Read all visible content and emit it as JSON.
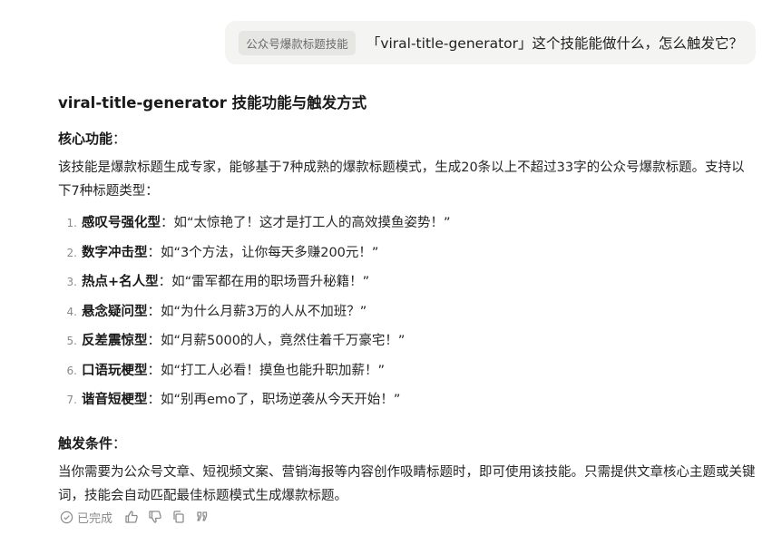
{
  "user_message": {
    "skill_tag": "公众号爆款标题技能",
    "text": "「viral-title-generator」这个技能能做什么，怎么触发它？"
  },
  "answer": {
    "heading": "viral-title-generator 技能功能与触发方式",
    "core": {
      "title": "核心功能",
      "colon": "：",
      "description": "该技能是爆款标题生成专家，能够基于7种成熟的爆款标题模式，生成20条以上不超过33字的公众号爆款标题。支持以下7种标题类型：",
      "items": [
        {
          "num": "1.",
          "name": "感叹号强化型",
          "sep": "：",
          "example": "如“太惊艳了！这才是打工人的高效摸鱼姿势！”"
        },
        {
          "num": "2.",
          "name": "数字冲击型",
          "sep": "：",
          "example": "如“3个方法，让你每天多赚200元！”"
        },
        {
          "num": "3.",
          "name": "热点+名人型",
          "sep": "：",
          "example": "如“雷军都在用的职场晋升秘籍！”"
        },
        {
          "num": "4.",
          "name": "悬念疑问型",
          "sep": "：",
          "example": "如“为什么月薪3万的人从不加班？”"
        },
        {
          "num": "5.",
          "name": "反差震惊型",
          "sep": "：",
          "example": "如“月薪5000的人，竟然住着千万豪宅！”"
        },
        {
          "num": "6.",
          "name": "口语玩梗型",
          "sep": "：",
          "example": "如“打工人必看！摸鱼也能升职加薪！”"
        },
        {
          "num": "7.",
          "name": "谐音短梗型",
          "sep": "：",
          "example": "如“别再emo了，职场逆袭从今天开始！”"
        }
      ]
    },
    "trigger": {
      "title": "触发条件",
      "colon": "：",
      "description": "当你需要为公众号文章、短视频文案、营销海报等内容创作吸睛标题时，即可使用该技能。只需提供文章核心主题或关键词，技能会自动匹配最佳标题模式生成爆款标题。"
    }
  },
  "footer": {
    "status_icon": "check-circle-icon",
    "status_label": "已完成",
    "actions": [
      "thumbs-up-icon",
      "thumbs-down-icon",
      "copy-icon",
      "quote-icon"
    ]
  }
}
